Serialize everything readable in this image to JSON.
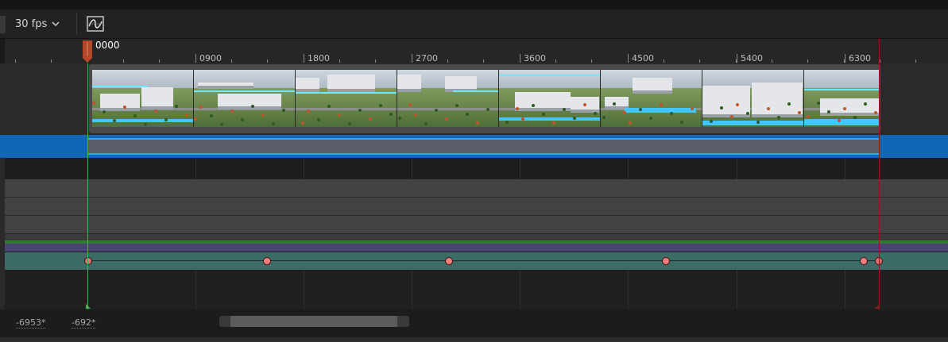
{
  "toolbar": {
    "fps_label": "30 fps",
    "curve_editor_icon": "curve-editor-icon"
  },
  "ruler": {
    "ticks": [
      "0900",
      "1800",
      "2700",
      "3600",
      "4500",
      "5400",
      "6300"
    ],
    "playhead_label": "0000"
  },
  "tracks": {
    "thumbnail_frames": 8,
    "keyframe_count": 6
  },
  "status": {
    "range_start": "-6953*",
    "range_end": "-692*"
  },
  "colors": {
    "selection": "#1266b8",
    "playhead": "#c0512f",
    "start_marker": "#4caf50",
    "end_marker": "#8b1a1a",
    "keyframe": "#f57f7f"
  }
}
